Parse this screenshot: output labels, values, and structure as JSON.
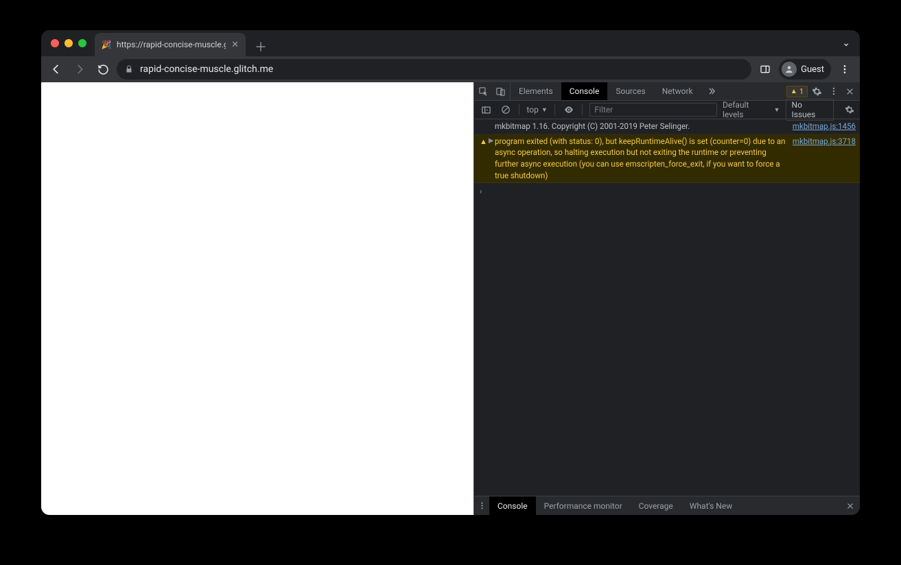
{
  "window": {
    "tab_title": "https://rapid-concise-muscle.g",
    "favicon": "🎉"
  },
  "toolbar": {
    "url": "rapid-concise-muscle.glitch.me",
    "guest_label": "Guest"
  },
  "devtools": {
    "tabs": [
      "Elements",
      "Console",
      "Sources",
      "Network"
    ],
    "active_tab": "Console",
    "warning_count": "1",
    "console_toolbar": {
      "context": "top",
      "filter_placeholder": "Filter",
      "levels_label": "Default levels",
      "issues_label": "No Issues"
    },
    "messages": [
      {
        "type": "info",
        "text": "mkbitmap 1.16. Copyright (C) 2001-2019 Peter Selinger.",
        "source": "mkbitmap.js:1456"
      },
      {
        "type": "warn",
        "text": "program exited (with status: 0), but keepRuntimeAlive() is set (counter=0) due to an async operation, so halting execution but not exiting the runtime or preventing further async execution (you can use emscripten_force_exit, if you want to force a true shutdown)",
        "source": "mkbitmap.js:3718"
      }
    ],
    "drawer_tabs": [
      "Console",
      "Performance monitor",
      "Coverage",
      "What's New"
    ],
    "drawer_active": "Console"
  }
}
